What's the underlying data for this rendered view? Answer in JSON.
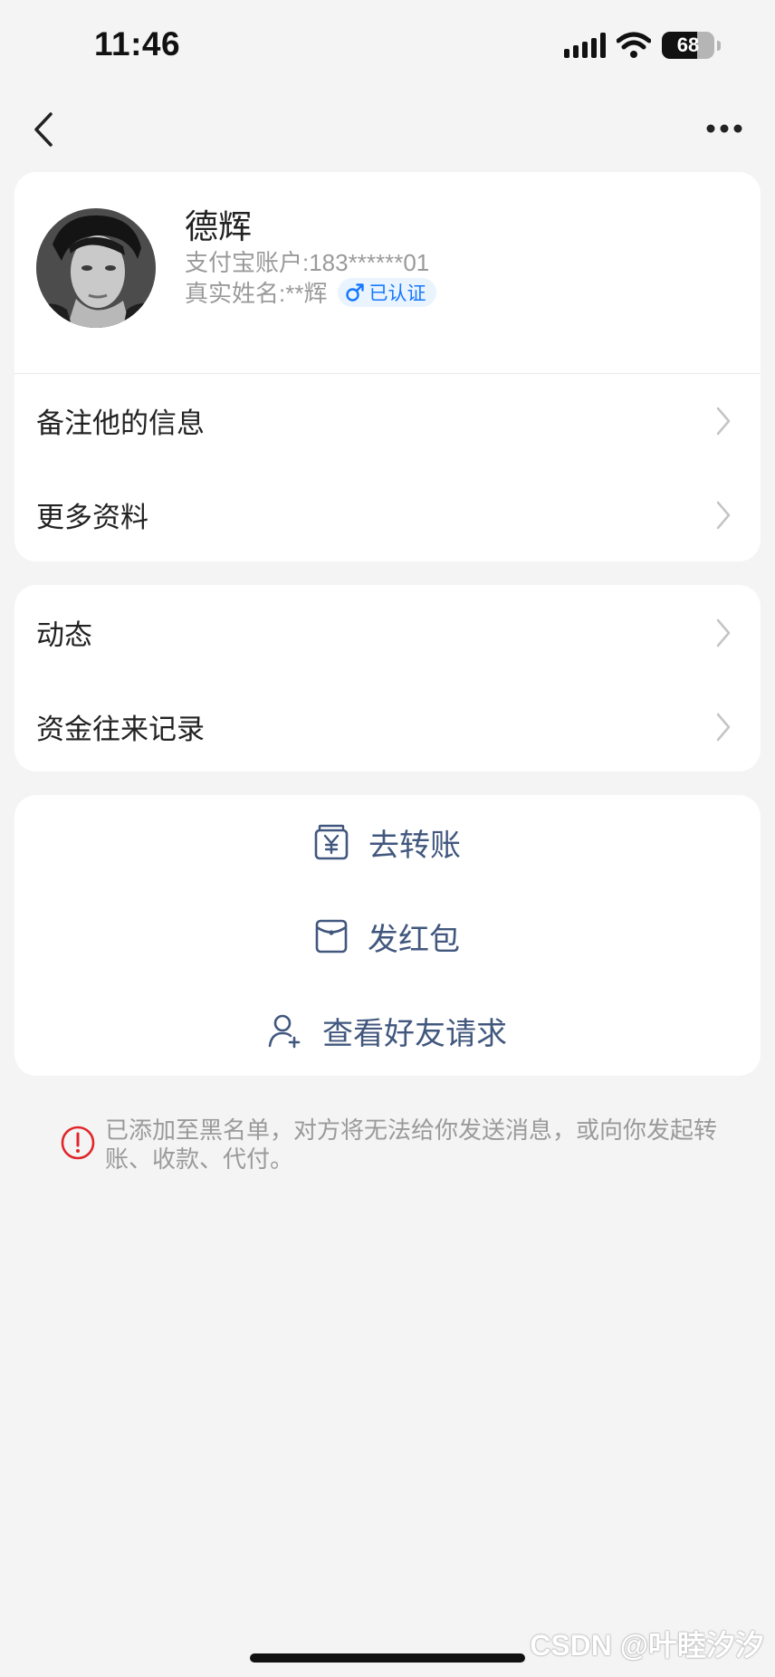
{
  "status_bar": {
    "time": "11:46",
    "battery_percent": "68",
    "battery_level": 0.68
  },
  "profile": {
    "name": "德辉",
    "account": "支付宝账户:183******01",
    "real_name": "真实姓名:**辉",
    "verified_label": "已认证"
  },
  "profile_menu": [
    {
      "label": "备注他的信息"
    },
    {
      "label": "更多资料"
    }
  ],
  "activity_menu": [
    {
      "label": "动态"
    },
    {
      "label": "资金往来记录"
    }
  ],
  "actions": [
    {
      "label": "去转账",
      "icon": "transfer-yuan-icon"
    },
    {
      "label": "发红包",
      "icon": "red-packet-icon"
    },
    {
      "label": "查看好友请求",
      "icon": "add-friend-icon"
    }
  ],
  "notice": {
    "text": "已添加至黑名单，对方将无法给你发送消息，或向你发起转账、收款、代付。"
  },
  "watermark": "CSDN @叶睦汐汐",
  "colors": {
    "accent_blue": "#1677ff",
    "action_text": "#41577e",
    "warning_red": "#e0262b"
  }
}
